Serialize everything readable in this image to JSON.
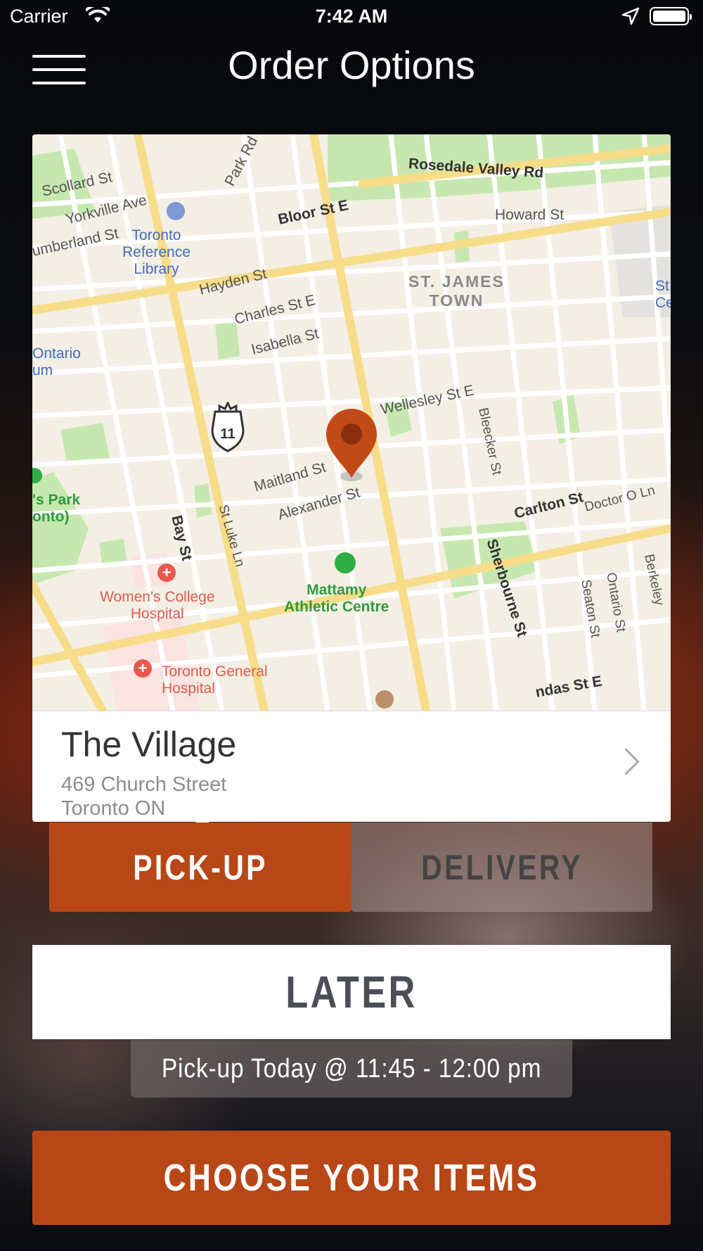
{
  "status_bar": {
    "carrier": "Carrier",
    "time": "7:42 AM"
  },
  "header": {
    "title": "Order Options"
  },
  "map": {
    "labels": {
      "scollard": "Scollard St",
      "yorkville": "Yorkville Ave",
      "cumberland": "umberland St",
      "library": "Toronto\nReference\nLibrary",
      "bloor": "Bloor St E",
      "rosedale": "Rosedale Valley Rd",
      "howard": "Howard St",
      "park_rd": "Park Rd",
      "hayden": "Hayden St",
      "charles": "Charles St E",
      "isabella": "Isabella St",
      "stjames": "ST. JAMES\nTOWN",
      "ontario_museum": "Ontario\num",
      "wellesley": "Wellesley St E",
      "bleecker": "Bleecker St",
      "route_number": "11",
      "maitland": "Maitland St",
      "alexander": "Alexander St",
      "stluke": "St Luke Ln",
      "bay": "Bay St",
      "park": "'s Park\nonto)",
      "carlton": "Carlton St",
      "doctor": "Doctor O Ln",
      "sherbourne": "Sherbourne St",
      "mattamy": "Mattamy\nAthletic Centre",
      "womens": "Women's College\nHospital",
      "general": "Toronto General\nHospital",
      "seaton": "Seaton St",
      "ontario_st": "Ontario St",
      "berkeley": "Berkeley",
      "dundas": "ndas St E",
      "edge_st": "St\nCe"
    }
  },
  "location": {
    "name": "The Village",
    "address_line1": "469 Church Street",
    "address_line2": "Toronto ON"
  },
  "order_type": {
    "pickup_label": "PICK-UP",
    "delivery_label": "DELIVERY",
    "selected": "PICK-UP"
  },
  "timing": {
    "later_label": "LATER",
    "pickup_time": "Pick-up Today @ 11:45 - 12:00 pm"
  },
  "cta": {
    "label": "CHOOSE YOUR ITEMS"
  },
  "colors": {
    "accent": "#b84718",
    "map_bg": "#f4efe4",
    "road_major": "#f7dc8a",
    "park": "#c6e8b0"
  }
}
